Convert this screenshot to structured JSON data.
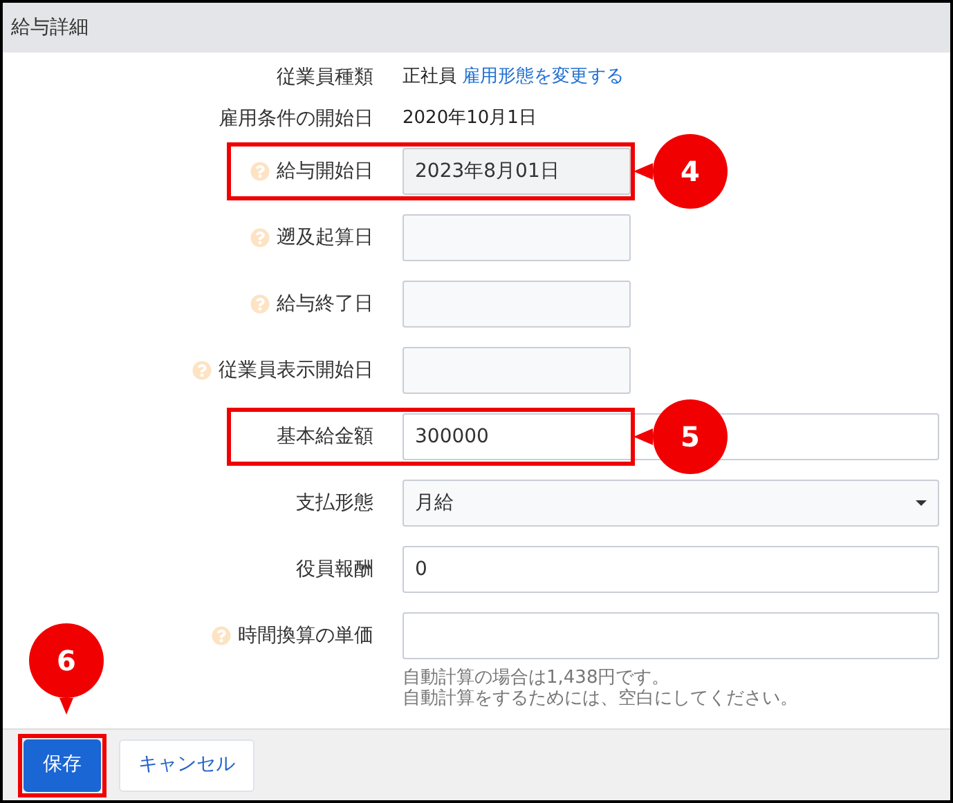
{
  "panel": {
    "title": "給与詳細"
  },
  "rows": [
    {
      "kind": "static",
      "label": "従業員種類",
      "help": false,
      "highlighted": false,
      "value": "正社員",
      "link": "雇用形態を変更する"
    },
    {
      "kind": "static",
      "label": "雇用条件の開始日",
      "help": false,
      "highlighted": false,
      "value": "2020年10月1日"
    },
    {
      "kind": "date",
      "label": "給与開始日",
      "help": true,
      "highlighted": true,
      "callout": "4",
      "value": "2023年8月01日"
    },
    {
      "kind": "date",
      "label": "遡及起算日",
      "help": true,
      "highlighted": false
    },
    {
      "kind": "date",
      "label": "給与終了日",
      "help": true,
      "highlighted": false
    },
    {
      "kind": "date",
      "label": "従業員表示開始日",
      "help": true,
      "highlighted": false
    },
    {
      "kind": "text",
      "label": "基本給金額",
      "help": false,
      "highlighted": true,
      "callout": "5",
      "value": "300000"
    },
    {
      "kind": "select",
      "label": "支払形態",
      "help": false,
      "highlighted": false,
      "value": "月給"
    },
    {
      "kind": "text",
      "label": "役員報酬",
      "help": false,
      "highlighted": false,
      "value": "0"
    },
    {
      "kind": "text",
      "label": "時間換算の単価",
      "help": true,
      "highlighted": false,
      "note_lines": [
        "自動計算の場合は1,438円です。",
        "自動計算をするためには、空白にしてください。"
      ]
    }
  ],
  "buttons": [
    {
      "kind": "primary",
      "label": "保存",
      "highlighted": true,
      "callout": "6"
    },
    {
      "kind": "secondary",
      "label": "キャンセル",
      "highlighted": false
    }
  ]
}
